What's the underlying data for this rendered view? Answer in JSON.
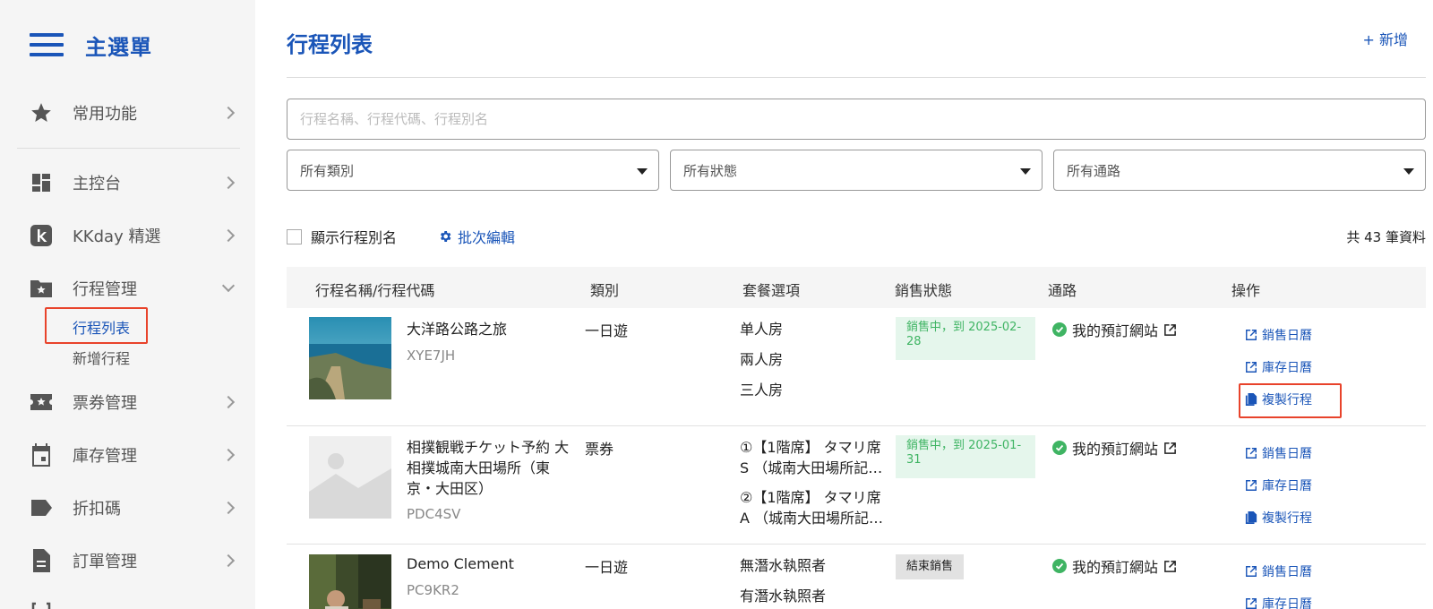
{
  "sidebar": {
    "title": "主選單",
    "items": [
      {
        "label": "常用功能"
      },
      {
        "label": "主控台"
      },
      {
        "label": "KKday 精選"
      },
      {
        "label": "行程管理"
      },
      {
        "label": "票券管理"
      },
      {
        "label": "庫存管理"
      },
      {
        "label": "折扣碼"
      },
      {
        "label": "訂單管理"
      }
    ],
    "sub_items": [
      {
        "label": "行程列表"
      },
      {
        "label": "新增行程"
      }
    ]
  },
  "header": {
    "title": "行程列表",
    "add_label": "新增"
  },
  "search": {
    "placeholder": "行程名稱、行程代碼、行程別名"
  },
  "filters": {
    "category": "所有類別",
    "status": "所有狀態",
    "channel": "所有通路"
  },
  "toolbar": {
    "show_alias_label": "顯示行程別名",
    "batch_edit_label": "批次編輯",
    "total_text": "共 43 筆資料"
  },
  "table": {
    "headers": {
      "name": "行程名稱/行程代碼",
      "category": "類別",
      "packages": "套餐選項",
      "status": "銷售狀態",
      "channel": "通路",
      "actions": "操作"
    },
    "actions": {
      "sales_calendar": "銷售日曆",
      "inventory_calendar": "庫存日曆",
      "copy": "複製行程"
    },
    "rows": [
      {
        "name": "大洋路公路之旅",
        "code": "XYE7JH",
        "category": "一日遊",
        "packages": [
          "单人房",
          "兩人房",
          "三人房"
        ],
        "status": "銷售中，到 2025-02-28",
        "channel": "我的預訂網站"
      },
      {
        "name": "相撲観戦チケット予約 大相撲城南大田場所（東京・大田区）",
        "code": "PDC4SV",
        "category": "票券",
        "packages": [
          "①【1階席】 タマリ席S （城南大田場所記…",
          "②【1階席】 タマリ席A （城南大田場所記…"
        ],
        "status": "銷售中，到 2025-01-31",
        "channel": "我的預訂網站"
      },
      {
        "name": "Demo Clement",
        "code": "PC9KR2",
        "category": "一日遊",
        "packages": [
          "無潛水執照者",
          "有潛水執照者"
        ],
        "status": "結束銷售",
        "channel": "我的預訂網站"
      }
    ]
  },
  "colors": {
    "accent": "#1a55b8",
    "highlight": "#e8432b",
    "success": "#3fb463"
  }
}
